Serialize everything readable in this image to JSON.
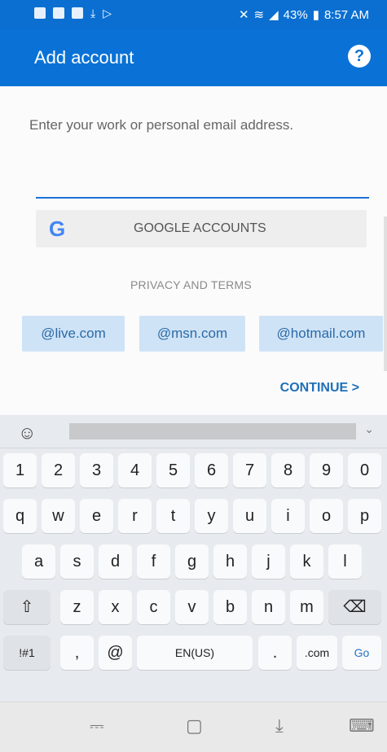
{
  "status_bar": {
    "battery": "43%",
    "time": "8:57 AM"
  },
  "app_bar": {
    "title": "Add account",
    "help_icon": "question-mark-icon"
  },
  "form": {
    "prompt": "Enter your work or personal email address.",
    "email_value": "",
    "email_placeholder": ""
  },
  "google_button": {
    "label": "GOOGLE ACCOUNTS",
    "icon": "google-g-icon"
  },
  "privacy_link": "PRIVACY AND TERMS",
  "domain_suggestions": [
    "@live.com",
    "@msn.com",
    "@hotmail.com"
  ],
  "continue_label": "CONTINUE",
  "keyboard": {
    "numbers": [
      "1",
      "2",
      "3",
      "4",
      "5",
      "6",
      "7",
      "8",
      "9",
      "0"
    ],
    "row1": [
      "q",
      "w",
      "e",
      "r",
      "t",
      "y",
      "u",
      "i",
      "o",
      "p"
    ],
    "row2": [
      "a",
      "s",
      "d",
      "f",
      "g",
      "h",
      "j",
      "k",
      "l"
    ],
    "row3": [
      "z",
      "x",
      "c",
      "v",
      "b",
      "n",
      "m"
    ],
    "symbols_label": "!#1",
    "comma": ",",
    "at": "@",
    "space_label": "EN(US)",
    "period": ".",
    "dotcom": ".com",
    "go_label": "Go"
  },
  "colors": {
    "accent": "#0a72d6",
    "chip_bg": "#cfe3f7"
  }
}
